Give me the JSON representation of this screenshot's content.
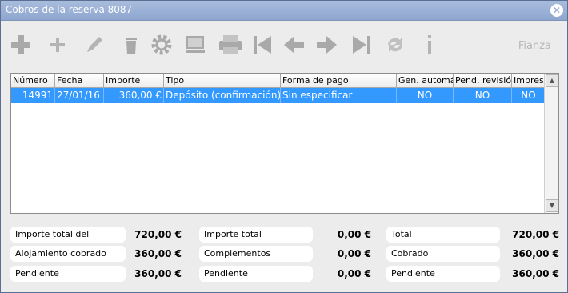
{
  "window": {
    "title": "Cobros de la reserva 8087"
  },
  "toolbar": {
    "buttons": [
      "plus-bold-icon",
      "plus-icon",
      "pencil-icon",
      "trash-icon",
      "gear-icon",
      "monitor-icon",
      "printer-icon",
      "first-icon",
      "prev-icon",
      "next-icon",
      "last-icon",
      "refresh-icon",
      "info-icon"
    ],
    "fianza_label": "Fianza"
  },
  "grid": {
    "columns": [
      "Número",
      "Fecha",
      "Importe",
      "Tipo",
      "Forma de pago",
      "Gen. automát.",
      "Pend. revisión",
      "Impreso"
    ],
    "rows": [
      {
        "numero": "14991",
        "fecha": "27/01/16",
        "importe": "360,00 €",
        "tipo": "Depósito (confirmación)",
        "forma_pago": "Sin especificar",
        "gen_automat": "NO",
        "pend_revision": "NO",
        "impreso": "NO"
      }
    ]
  },
  "summary": {
    "alojamiento": {
      "total_label": "Importe total del alojamiento",
      "total_value": "720,00 €",
      "cobrado_label": "Alojamiento cobrado",
      "cobrado_value": "360,00 €",
      "pendiente_label": "Pendiente",
      "pendiente_value": "360,00 €"
    },
    "complementos": {
      "total_label": "Importe total complementos",
      "total_value": "0,00 €",
      "cobrado_label": "Complementos cobrados",
      "cobrado_value": "0,00 €",
      "pendiente_label": "Pendiente",
      "pendiente_value": "0,00 €"
    },
    "general": {
      "total_label": "Total",
      "total_value": "720,00 €",
      "cobrado_label": "Cobrado",
      "cobrado_value": "360,00 €",
      "pendiente_label": "Pendiente",
      "pendiente_value": "360,00 €"
    }
  }
}
